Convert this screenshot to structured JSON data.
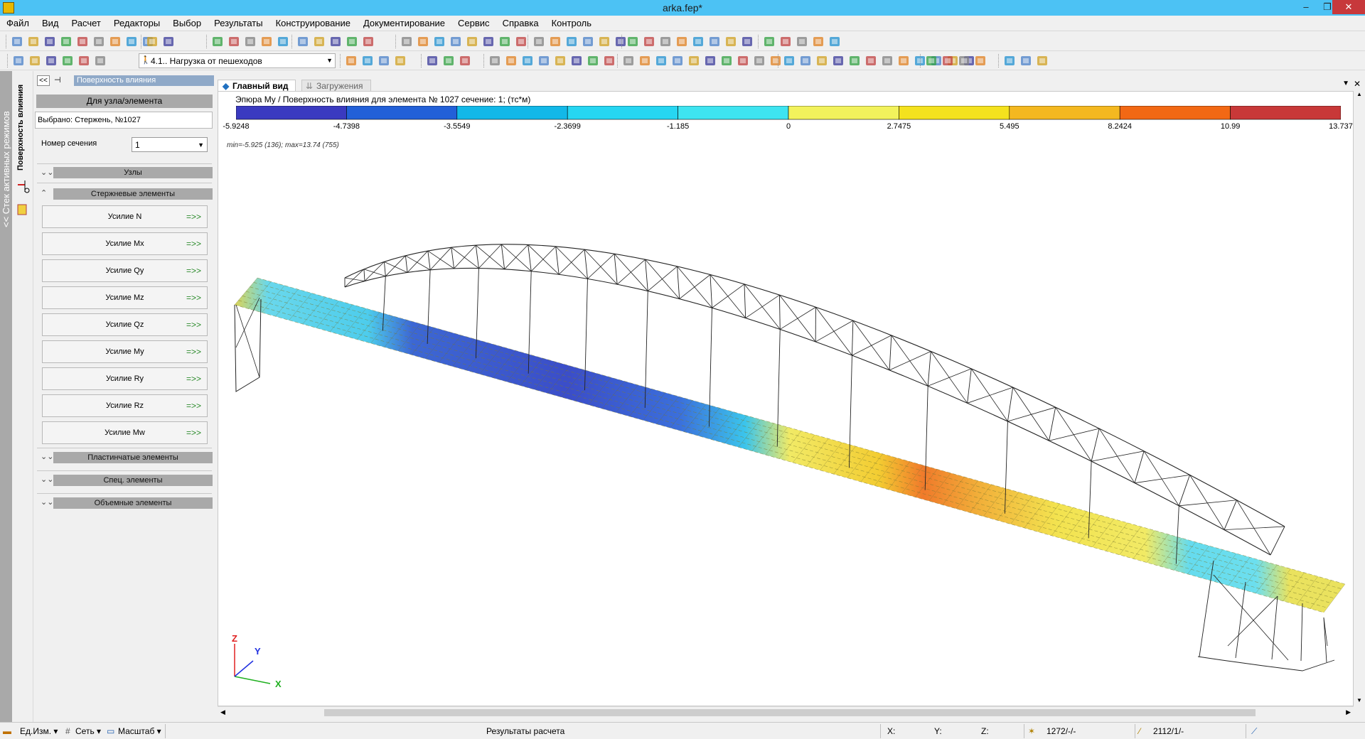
{
  "window": {
    "title": "arka.fep*"
  },
  "menu": [
    "Файл",
    "Вид",
    "Расчет",
    "Редакторы",
    "Выбор",
    "Результаты",
    "Конструирование",
    "Документирование",
    "Сервис",
    "Справка",
    "Контроль"
  ],
  "toolbar2": {
    "load_case": "4.1.. Нагрузка от пешеходов"
  },
  "left_strip": {
    "label": "<< Стек активных режимов"
  },
  "side_tab": {
    "label": "Поверхность влияния"
  },
  "panel": {
    "title": "Поверхность влияния",
    "mode_button": "Для узла/элемента",
    "selected": "Выбрано:  Стержень, №1027",
    "section_label": "Номер сечения",
    "section_value": "1",
    "groups": {
      "nodes": "Узлы",
      "rods": "Стержневые элементы",
      "plates": "Пластинчатые элементы",
      "special": "Спец. элементы",
      "volume": "Объемные элементы"
    },
    "forces": [
      "Усилие N",
      "Усилие Mx",
      "Усилие Qy",
      "Усилие Mz",
      "Усилие Qz",
      "Усилие My",
      "Усилие Ry",
      "Усилие Rz",
      "Усилие Mw"
    ],
    "arrow": "=>>"
  },
  "tabs": {
    "main": "Главный вид",
    "loads": "Загружения"
  },
  "legend": {
    "title": "Эпюра My / Поверхность влияния для элемента № 1027 сечение: 1; (тс*м)",
    "ticks": [
      "-5.9248",
      "-4.7398",
      "-3.5549",
      "-2.3699",
      "-1.185",
      "0",
      "2.7475",
      "5.495",
      "8.2424",
      "10.99",
      "13.737"
    ],
    "colors": [
      "#3a3ac0",
      "#2260d8",
      "#12b8e8",
      "#26d6f2",
      "#3ee4f0",
      "#f2f25c",
      "#f4e21e",
      "#f4b820",
      "#f26814",
      "#c83838"
    ]
  },
  "view": {
    "minmax": "min=-5.925 (136); max=13.74 (755)"
  },
  "axes": {
    "x": "X",
    "y": "Y",
    "z": "Z"
  },
  "status": {
    "units": "Ед.Изм.",
    "grid": "Сеть",
    "scale": "Масштаб",
    "center": "Результаты расчета",
    "x": "X:",
    "y": "Y:",
    "z": "Z:",
    "nodes": "1272/-/-",
    "elements": "2112/1/-"
  }
}
